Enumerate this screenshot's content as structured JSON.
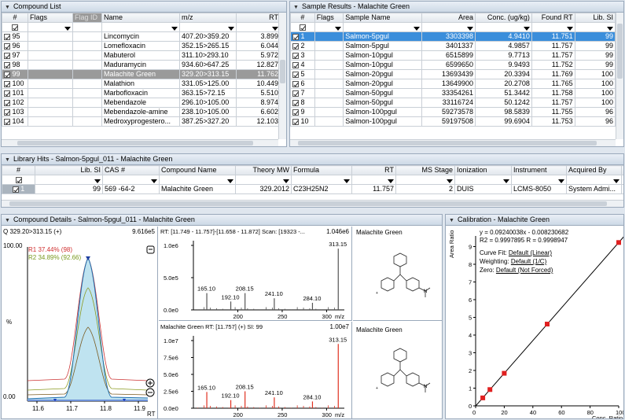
{
  "compound_list": {
    "title": "Compound List",
    "columns": [
      "#",
      "Flags",
      "Flag ID",
      "Name",
      "m/z",
      "RT"
    ],
    "rows": [
      {
        "n": "95",
        "name": "Lincomycin",
        "mz": "407.20>359.20",
        "rt": "3.899",
        "sel": false
      },
      {
        "n": "96",
        "name": "Lomefloxacin",
        "mz": "352.15>265.15",
        "rt": "6.044",
        "sel": false
      },
      {
        "n": "97",
        "name": "Mabuterol",
        "mz": "311.10>293.10",
        "rt": "5.972",
        "sel": false
      },
      {
        "n": "98",
        "name": "Maduramycin",
        "mz": "934.60>647.25",
        "rt": "12.827",
        "sel": false
      },
      {
        "n": "99",
        "name": "Malachite Green",
        "mz": "329.20>313.15",
        "rt": "11.762",
        "sel": true
      },
      {
        "n": "100",
        "name": "Malathion",
        "mz": "331.05>125.00",
        "rt": "10.449",
        "sel": false
      },
      {
        "n": "101",
        "name": "Marbofloxacin",
        "mz": "363.15>72.15",
        "rt": "5.510",
        "sel": false
      },
      {
        "n": "102",
        "name": "Mebendazole",
        "mz": "296.10>105.00",
        "rt": "8.974",
        "sel": false
      },
      {
        "n": "103",
        "name": "Mebendazole-amine",
        "mz": "238.10>105.00",
        "rt": "6.602",
        "sel": false
      },
      {
        "n": "104",
        "name": "Medroxyprogestero...",
        "mz": "387.25>327.20",
        "rt": "12.103",
        "sel": false
      }
    ]
  },
  "sample_results": {
    "title": "Sample Results - Malachite Green",
    "columns": [
      "#",
      "Flags",
      "Sample Name",
      "Area",
      "Conc. (ug/kg)",
      "Found RT",
      "Lib. SI"
    ],
    "rows": [
      {
        "n": "1",
        "name": "Salmon-5pgul",
        "area": "3303398",
        "conc": "4.9410",
        "rt": "11.751",
        "si": "99",
        "sel": true
      },
      {
        "n": "2",
        "name": "Salmon-5pgul",
        "area": "3401337",
        "conc": "4.9857",
        "rt": "11.757",
        "si": "99",
        "sel": false
      },
      {
        "n": "3",
        "name": "Salmon-10pgul",
        "area": "6515899",
        "conc": "9.7713",
        "rt": "11.757",
        "si": "99",
        "sel": false
      },
      {
        "n": "4",
        "name": "Salmon-10pgul",
        "area": "6599650",
        "conc": "9.9493",
        "rt": "11.752",
        "si": "99",
        "sel": false
      },
      {
        "n": "5",
        "name": "Salmon-20pgul",
        "area": "13693439",
        "conc": "20.3394",
        "rt": "11.769",
        "si": "100",
        "sel": false
      },
      {
        "n": "6",
        "name": "Salmon-20pgul",
        "area": "13649900",
        "conc": "20.2708",
        "rt": "11.765",
        "si": "100",
        "sel": false
      },
      {
        "n": "7",
        "name": "Salmon-50pgul",
        "area": "33354261",
        "conc": "51.3442",
        "rt": "11.758",
        "si": "100",
        "sel": false
      },
      {
        "n": "8",
        "name": "Salmon-50pgul",
        "area": "33116724",
        "conc": "50.1242",
        "rt": "11.757",
        "si": "100",
        "sel": false
      },
      {
        "n": "9",
        "name": "Salmon-100pgul",
        "area": "59273578",
        "conc": "98.5839",
        "rt": "11.755",
        "si": "96",
        "sel": false
      },
      {
        "n": "10",
        "name": "Salmon-100pgul",
        "area": "59197508",
        "conc": "99.6904",
        "rt": "11.753",
        "si": "96",
        "sel": false
      }
    ]
  },
  "library_hits": {
    "title": "Library Hits - Salmon-5pgul_011 - Malachite Green",
    "columns": [
      "#",
      "Lib. SI",
      "CAS #",
      "Compound Name",
      "Theory MW",
      "Formula",
      "RT",
      "MS Stage",
      "Ionization",
      "Instrument",
      "Acquired By"
    ],
    "row": {
      "n": "1",
      "si": "99",
      "cas": "569    -64-2",
      "name": "Malachite Green",
      "mw": "329.2012",
      "formula": "C23H25N2",
      "rt": "11.757",
      "stage": "2",
      "ion": "DUIS",
      "inst": "LCMS-8050",
      "acq": "System Admi..."
    }
  },
  "details": {
    "title": "Compound Details - Salmon-5pgul_011 - Malachite Green",
    "chrom": {
      "header": "Q 329.20>313.15 (+)",
      "max": "9.616e5",
      "y_top": "100.00",
      "y_mid": "%",
      "y_bottom": "0.00",
      "r1": "R1 37.44% (98)",
      "r2": "R2 34.89% (92.66)",
      "x_ticks": [
        "11.6",
        "11.7",
        "11.8",
        "11.9"
      ],
      "x_label": "RT"
    },
    "spec1": {
      "header": "RT: [11.749 - 11.757]-[11.658 - 11.872] Scan: [19323 -...",
      "max": "1.046e6",
      "y_ticks": [
        "1.0e6",
        "5.0e5",
        "0.0e0"
      ],
      "x_ticks": [
        "200",
        "250",
        "300"
      ],
      "x_label": "m/z",
      "peaks": [
        {
          "mz": 165.1,
          "i": 0.26,
          "label": "165.10"
        },
        {
          "mz": 192.1,
          "i": 0.13,
          "label": "192.10"
        },
        {
          "mz": 208.15,
          "i": 0.26,
          "label": "208.15"
        },
        {
          "mz": 241.1,
          "i": 0.18,
          "label": "241.10"
        },
        {
          "mz": 284.1,
          "i": 0.11,
          "label": "284.10"
        },
        {
          "mz": 313.15,
          "i": 0.95,
          "label": "313.15"
        }
      ]
    },
    "spec2": {
      "header": "Malachite Green RT: [11.757] (+) SI: 99",
      "max": "1.00e7",
      "y_ticks": [
        "1.0e7",
        "7.5e6",
        "5.0e6",
        "2.5e6",
        "0.0e0"
      ],
      "x_ticks": [
        "200",
        "250",
        "300"
      ],
      "x_label": "m/z",
      "peaks": [
        {
          "mz": 165.1,
          "i": 0.24,
          "label": "165.10"
        },
        {
          "mz": 192.1,
          "i": 0.12,
          "label": "192.10"
        },
        {
          "mz": 208.15,
          "i": 0.25,
          "label": "208.15"
        },
        {
          "mz": 241.1,
          "i": 0.16,
          "label": "241.10"
        },
        {
          "mz": 284.1,
          "i": 0.1,
          "label": "284.10"
        },
        {
          "mz": 313.15,
          "i": 0.95,
          "label": "313.15"
        }
      ]
    },
    "struct1": "Malachite Green",
    "struct2": "Malachite Green"
  },
  "calibration": {
    "title": "Calibration - Malachite Green",
    "eq": "y = 0.09240038x - 0.008230682",
    "r2": "R2 = 0.9997895    R = 0.9998947",
    "fit_label": "Curve Fit:",
    "fit": "Default (Linear)",
    "weight_label": "Weighting:",
    "weight": "Default (1/C)",
    "zero_label": "Zero:",
    "zero": "Default (Not Forced)",
    "y_label": "Area Ratio",
    "x_label": "Conc. Ratio",
    "y_ticks": [
      "0",
      "1",
      "2",
      "3",
      "4",
      "5",
      "6",
      "7",
      "8",
      "9"
    ],
    "x_ticks": [
      "0",
      "20",
      "40",
      "60",
      "80",
      "100"
    ]
  },
  "chart_data": {
    "type": "scatter",
    "title": "Calibration - Malachite Green",
    "xlabel": "Conc. Ratio",
    "ylabel": "Area Ratio",
    "xlim": [
      0,
      100
    ],
    "ylim": [
      0,
      9.6
    ],
    "x": [
      5,
      10,
      20,
      50,
      100
    ],
    "y": [
      0.45,
      0.92,
      1.84,
      4.62,
      9.23
    ],
    "slope": 0.09240038,
    "intercept": -0.008230682
  },
  "colors": {
    "selection": "#3b8edb",
    "chrom_fill": "#bfe3f0",
    "peak_red": "#e03020",
    "cal_point": "#e02020"
  }
}
